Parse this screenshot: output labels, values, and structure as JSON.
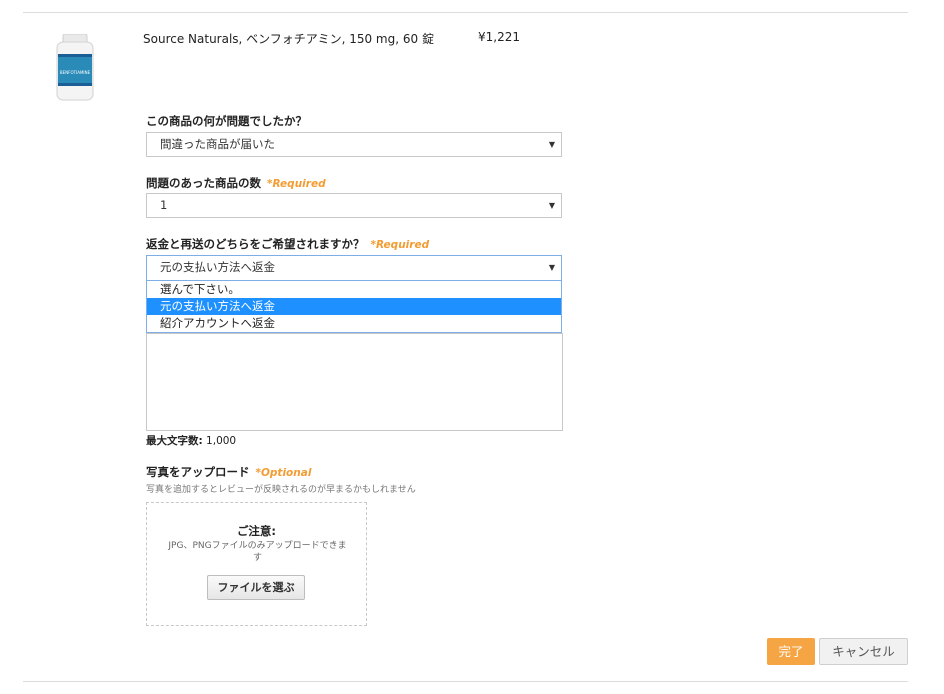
{
  "product": {
    "name": "Source Naturals, ベンフォチアミン, 150 mg, 60 錠",
    "price": "¥1,221",
    "bottle_label": "BENFOTIAMINE"
  },
  "q_problem": {
    "label": "この商品の何が問題でしたか？",
    "value": "間違った商品が届いた"
  },
  "q_quantity": {
    "label": "問題のあった商品の数",
    "required": "*Required",
    "value": "1"
  },
  "q_resolution": {
    "label": "返金と再送のどちらをご希望されますか？",
    "required": "*Required",
    "value": "元の支払い方法へ返金",
    "options": [
      "選んで下さい。",
      "元の支払い方法へ返金",
      "紹介アカウントへ返金"
    ]
  },
  "comment": {
    "max_label": "最大文字数:",
    "max_value": "1,000"
  },
  "upload": {
    "title": "写真をアップロード",
    "optional": "*Optional",
    "subtitle": "写真を追加するとレビューが反映されるのが早まるかもしれません",
    "notice_title": "ご注意:",
    "notice_body": "JPG、PNGファイルのみアップロードできます",
    "choose_button": "ファイルを選ぶ"
  },
  "actions": {
    "done": "完了",
    "cancel": "キャンセル"
  }
}
